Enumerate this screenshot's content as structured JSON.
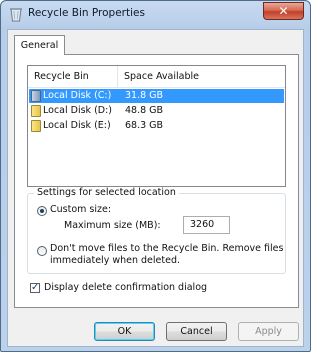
{
  "window": {
    "title": "Recycle Bin Properties",
    "close_label": "✕"
  },
  "tabs": [
    {
      "label": "General"
    }
  ],
  "list": {
    "columns": [
      "Recycle Bin Location",
      "Space Available"
    ],
    "rows": [
      {
        "name": "Local Disk (C:)",
        "space": "31.8 GB",
        "selected": true
      },
      {
        "name": "Local Disk (D:)",
        "space": "48.8 GB",
        "selected": false
      },
      {
        "name": "Local Disk (E:)",
        "space": "68.3 GB",
        "selected": false
      }
    ]
  },
  "settings": {
    "group_label": "Settings for selected location",
    "custom_size_label": "Custom size:",
    "max_size_label": "Maximum size (MB):",
    "max_size_value": "3260",
    "dont_move_line1": "Don't move files to the Recycle Bin. Remove files",
    "dont_move_line2": "immediately when deleted.",
    "confirm_label": "Display delete confirmation dialog"
  },
  "buttons": {
    "ok": "OK",
    "cancel": "Cancel",
    "apply": "Apply"
  },
  "icons": {
    "title": "recycle-bin-icon",
    "drive": "drive-icon",
    "close": "close-icon"
  }
}
